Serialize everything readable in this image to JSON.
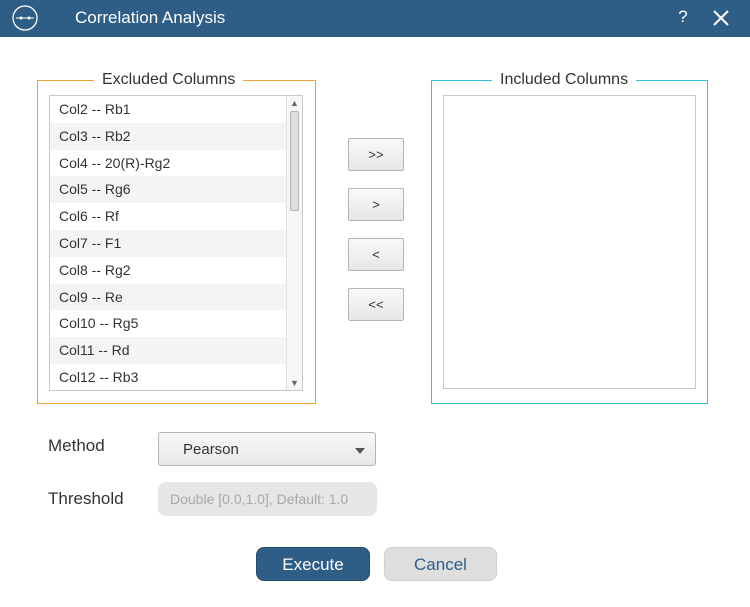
{
  "window": {
    "title": "Correlation Analysis",
    "help_label": "?"
  },
  "excluded": {
    "label": "Excluded Columns",
    "items": [
      "Col2 -- Rb1",
      "Col3 -- Rb2",
      "Col4 -- 20(R)-Rg2",
      "Col5 -- Rg6",
      "Col6 -- Rf",
      "Col7 -- F1",
      "Col8 -- Rg2",
      "Col9 -- Re",
      "Col10 -- Rg5",
      "Col11 -- Rd",
      "Col12 -- Rb3"
    ]
  },
  "included": {
    "label": "Included Columns",
    "items": []
  },
  "move_buttons": {
    "add_all": ">>",
    "add": ">",
    "remove": "<",
    "remove_all": "<<"
  },
  "method": {
    "label": "Method",
    "value": "Pearson"
  },
  "threshold": {
    "label": "Threshold",
    "placeholder": "Double [0.0,1.0], Default: 1.0",
    "value": ""
  },
  "actions": {
    "execute": "Execute",
    "cancel": "Cancel"
  },
  "colors": {
    "titlebar": "#2e5d86",
    "excluded_border": "#f0a030",
    "included_border": "#33c2d6",
    "primary_button": "#2e5d86"
  },
  "icons": {
    "app_logo": "app-logo-icon",
    "close": "close-icon",
    "dropdown": "chevron-down-icon"
  }
}
